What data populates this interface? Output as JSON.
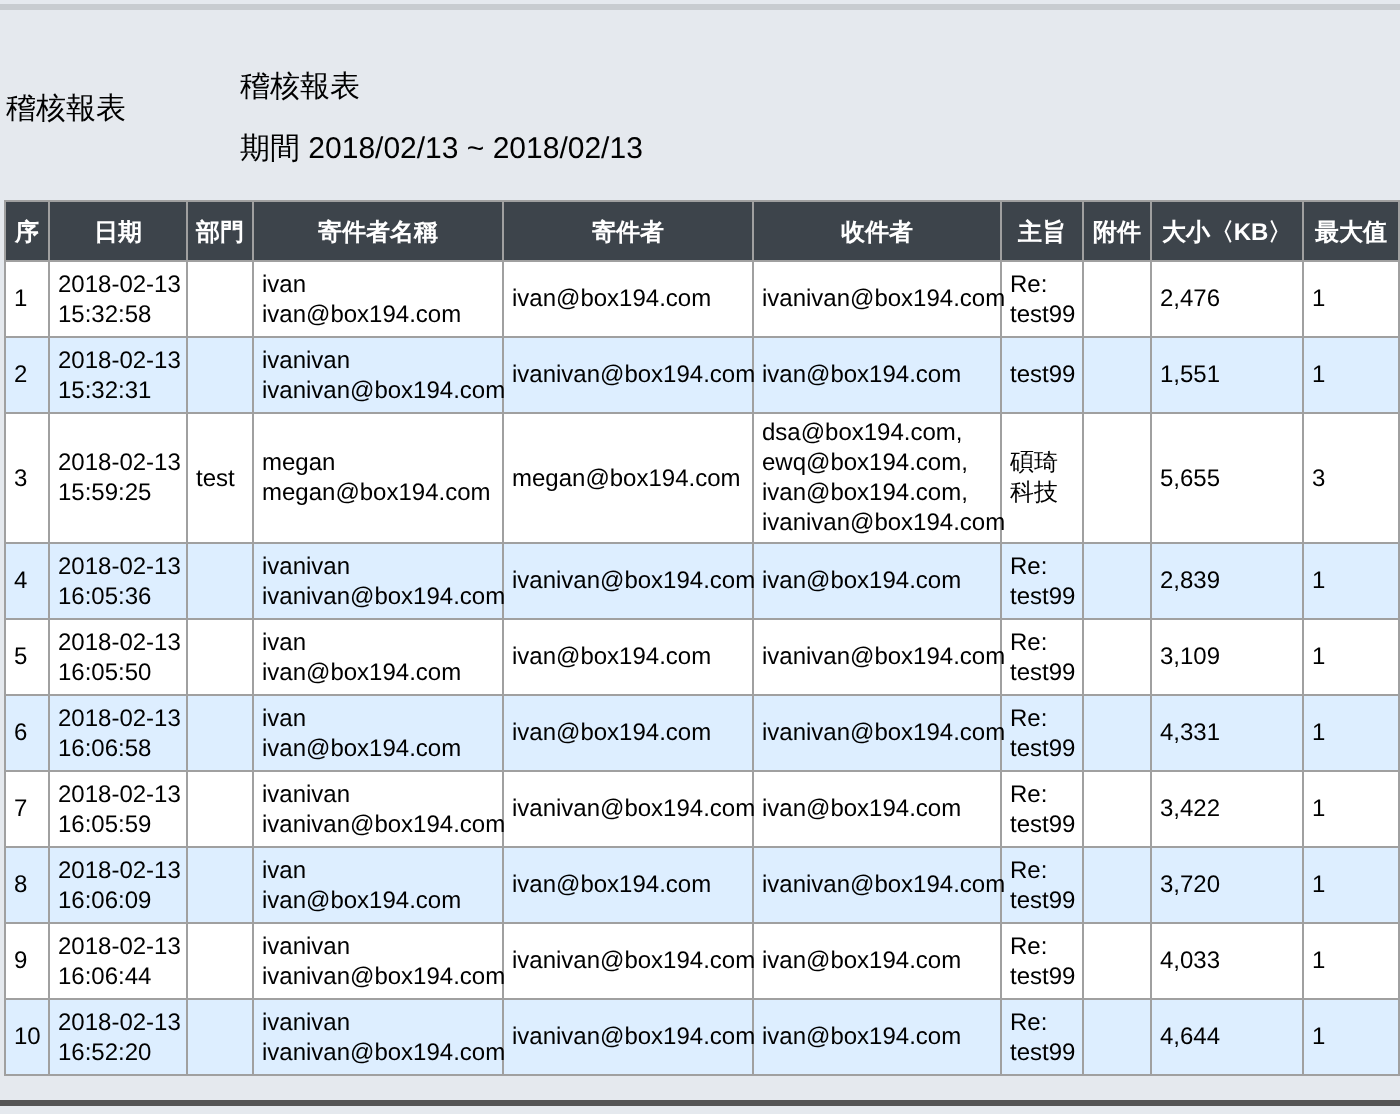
{
  "side_title": "稽核報表",
  "report": {
    "title": "稽核報表",
    "period": "期間 2018/02/13 ~ 2018/02/13"
  },
  "table": {
    "columns": [
      "序",
      "日期",
      "部門",
      "寄件者名稱",
      "寄件者",
      "收件者",
      "主旨",
      "附件",
      "大小〈KB〉",
      "最大值"
    ],
    "rows": [
      {
        "no": "1",
        "date": [
          "2018-02-13",
          "15:32:58"
        ],
        "dept": "",
        "sender_name": [
          "ivan",
          "ivan@box194.com"
        ],
        "sender": "ivan@box194.com",
        "recipients": [
          "ivanivan@box194.com"
        ],
        "subject": [
          "Re:",
          "test99"
        ],
        "attachment": "",
        "size": "2,476",
        "max": "1"
      },
      {
        "no": "2",
        "date": [
          "2018-02-13",
          "15:32:31"
        ],
        "dept": "",
        "sender_name": [
          "ivanivan",
          "ivanivan@box194.com"
        ],
        "sender": "ivanivan@box194.com",
        "recipients": [
          "ivan@box194.com"
        ],
        "subject": [
          "test99"
        ],
        "attachment": "",
        "size": "1,551",
        "max": "1"
      },
      {
        "no": "3",
        "date": [
          "2018-02-13",
          "15:59:25"
        ],
        "dept": "test",
        "sender_name": [
          "megan",
          "megan@box194.com"
        ],
        "sender": "megan@box194.com",
        "recipients": [
          "dsa@box194.com,",
          "ewq@box194.com,",
          "ivan@box194.com,",
          "ivanivan@box194.com"
        ],
        "subject": [
          "碩琦",
          "科技"
        ],
        "attachment": "",
        "size": "5,655",
        "max": "3"
      },
      {
        "no": "4",
        "date": [
          "2018-02-13",
          "16:05:36"
        ],
        "dept": "",
        "sender_name": [
          "ivanivan",
          "ivanivan@box194.com"
        ],
        "sender": "ivanivan@box194.com",
        "recipients": [
          "ivan@box194.com"
        ],
        "subject": [
          "Re:",
          "test99"
        ],
        "attachment": "",
        "size": "2,839",
        "max": "1"
      },
      {
        "no": "5",
        "date": [
          "2018-02-13",
          "16:05:50"
        ],
        "dept": "",
        "sender_name": [
          "ivan",
          "ivan@box194.com"
        ],
        "sender": "ivan@box194.com",
        "recipients": [
          "ivanivan@box194.com"
        ],
        "subject": [
          "Re:",
          "test99"
        ],
        "attachment": "",
        "size": "3,109",
        "max": "1"
      },
      {
        "no": "6",
        "date": [
          "2018-02-13",
          "16:06:58"
        ],
        "dept": "",
        "sender_name": [
          "ivan",
          "ivan@box194.com"
        ],
        "sender": "ivan@box194.com",
        "recipients": [
          "ivanivan@box194.com"
        ],
        "subject": [
          "Re:",
          "test99"
        ],
        "attachment": "",
        "size": "4,331",
        "max": "1"
      },
      {
        "no": "7",
        "date": [
          "2018-02-13",
          "16:05:59"
        ],
        "dept": "",
        "sender_name": [
          "ivanivan",
          "ivanivan@box194.com"
        ],
        "sender": "ivanivan@box194.com",
        "recipients": [
          "ivan@box194.com"
        ],
        "subject": [
          "Re:",
          "test99"
        ],
        "attachment": "",
        "size": "3,422",
        "max": "1"
      },
      {
        "no": "8",
        "date": [
          "2018-02-13",
          "16:06:09"
        ],
        "dept": "",
        "sender_name": [
          "ivan",
          "ivan@box194.com"
        ],
        "sender": "ivan@box194.com",
        "recipients": [
          "ivanivan@box194.com"
        ],
        "subject": [
          "Re:",
          "test99"
        ],
        "attachment": "",
        "size": "3,720",
        "max": "1"
      },
      {
        "no": "9",
        "date": [
          "2018-02-13",
          "16:06:44"
        ],
        "dept": "",
        "sender_name": [
          "ivanivan",
          "ivanivan@box194.com"
        ],
        "sender": "ivanivan@box194.com",
        "recipients": [
          "ivan@box194.com"
        ],
        "subject": [
          "Re:",
          "test99"
        ],
        "attachment": "",
        "size": "4,033",
        "max": "1"
      },
      {
        "no": "10",
        "date": [
          "2018-02-13",
          "16:52:20"
        ],
        "dept": "",
        "sender_name": [
          "ivanivan",
          "ivanivan@box194.com"
        ],
        "sender": "ivanivan@box194.com",
        "recipients": [
          "ivan@box194.com"
        ],
        "subject": [
          "Re:",
          "test99"
        ],
        "attachment": "",
        "size": "4,644",
        "max": "1"
      }
    ]
  }
}
